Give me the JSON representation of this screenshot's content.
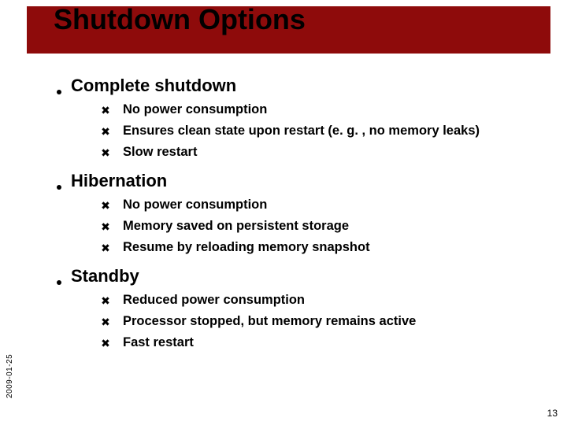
{
  "title": "Shutdown Options",
  "sections": [
    {
      "heading": "Complete shutdown",
      "items": [
        "No power consumption",
        "Ensures clean state upon restart (e. g. , no memory leaks)",
        "Slow restart"
      ]
    },
    {
      "heading": "Hibernation",
      "items": [
        "No power consumption",
        "Memory saved on persistent storage",
        "Resume by reloading memory snapshot"
      ]
    },
    {
      "heading": "Standby",
      "items": [
        "Reduced power consumption",
        "Processor stopped, but memory remains active",
        "Fast restart"
      ]
    }
  ],
  "date": "2009-01-25",
  "page_number": "13",
  "l2_marker": "✖"
}
